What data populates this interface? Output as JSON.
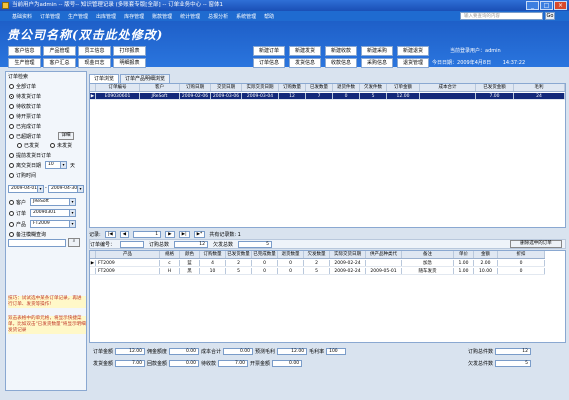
{
  "window": {
    "title": "当前用户为admin -- 版号-- 知识管理记录 (多账套专版[全部] -- 订单业务中心 -- 窗体1",
    "buttons": [
      "_",
      "□",
      "×"
    ]
  },
  "menu": [
    "基础资料",
    "订单管理",
    "生产管理",
    "出库管理",
    "库存管理",
    "账款管理",
    "统计管理",
    "总报分析",
    "系统管理",
    "帮助"
  ],
  "search": {
    "placeholder": "输入要查询的内容",
    "go": "Go"
  },
  "header": {
    "brand": "贵公司名称(双击此处修改)",
    "left_buttons": [
      "客户信息",
      "产品管理",
      "员工信息",
      "打印报表",
      "生产管理",
      "客户汇总",
      "现金日志",
      "明细报表"
    ],
    "mid_buttons": [
      "新建订单",
      "新建发货",
      "新建收款",
      "新建采购",
      "新建退货",
      "订单信息",
      "发货信息",
      "收款信息",
      "采购信息",
      "退货管理"
    ],
    "current_user_label": "当前登录用户：",
    "current_user": "admin",
    "today_label": "今日日期：",
    "today": "2009年4月8日",
    "time": "14:37:22"
  },
  "left": {
    "section_title": "订单检索",
    "radios": [
      {
        "label": "全部订单",
        "on": false
      },
      {
        "label": "待发货订单",
        "on": true
      },
      {
        "label": "待收款订单",
        "on": false
      },
      {
        "label": "待开票订单",
        "on": false
      },
      {
        "label": "已完成订单",
        "on": false
      },
      {
        "label": "已超期订单",
        "on": false
      }
    ],
    "detail_button": "详细",
    "sub_radios": [
      "已发货",
      "未发货"
    ],
    "upcoming_label": "提前发货日订单",
    "days_label": "离交货日期",
    "days_value": "10",
    "days_unit": "天",
    "order_date_label": "订购时间",
    "date_from": "2009-04-01",
    "date_to": "2009-04-30",
    "customer_label": "客户",
    "customer_value": "JReSoft",
    "order_label": "订单",
    "order_value": "20090301",
    "product_label": "产品",
    "product_value": "FT2009",
    "remark_label": "备注模糊查询",
    "tip1": "技巧：试试选中某条订单记录，再进行订单、发货等操作!",
    "tip2": "双击表格中的单元格，将显示快捷菜单，比如双击\"已发货数量\"将显示明细发货记录"
  },
  "tabs": [
    "订单浏览",
    "订单产品明细浏览"
  ],
  "orders": {
    "columns": [
      "订单编号",
      "客户",
      "订购日期",
      "交货日期",
      "实际交货日期",
      "订购数量",
      "已发数量",
      "退货件数",
      "欠发件数",
      "订单金额",
      "成本合计",
      "已发货金额",
      "毛利"
    ],
    "rows": [
      [
        "E09030601",
        "JReSoft",
        "2009-02-06",
        "2009-03-06",
        "2009-03-04",
        "12",
        "7",
        "0",
        "5",
        "12.00",
        "",
        "7.00",
        "24"
      ]
    ]
  },
  "nav": {
    "label": "记录:",
    "current": "1",
    "total_label": "共有记录数: 1"
  },
  "detail_info": {
    "order_label": "订单编号：",
    "order_value": "",
    "qty_label": "订购总数",
    "qty_value": "12",
    "short_label": "欠发总数",
    "short_value": "5",
    "delete_button": "删除选中的订单"
  },
  "details": {
    "columns": [
      "产品",
      "规格",
      "颜色",
      "订购数量",
      "已发货数量",
      "已完成数量",
      "退货数量",
      "欠发数量",
      "实际交货日期",
      "供产品种类代",
      "备注",
      "单价",
      "金额",
      "折扣"
    ],
    "rows": [
      [
        "FT2009",
        "c",
        "蓝",
        "4",
        "2",
        "0",
        "0",
        "2",
        "2009-02-24",
        "",
        "加急",
        "1.00",
        "2.00",
        "0"
      ],
      [
        "FT2009",
        "H",
        "黑",
        "10",
        "5",
        "0",
        "0",
        "5",
        "2009-02-24",
        "2009-05-01",
        "随车发货",
        "1.00",
        "10.00",
        "0"
      ]
    ]
  },
  "summary": {
    "row1": [
      {
        "label": "订单金额",
        "value": "12.00"
      },
      {
        "label": "佣金额度",
        "value": "0.00"
      },
      {
        "label": "成本合计",
        "value": "0.00"
      },
      {
        "label": "预测毛利",
        "value": "12.00"
      },
      {
        "label": "毛利率",
        "value": "100"
      }
    ],
    "row2": [
      {
        "label": "发货金额",
        "value": "7.00"
      },
      {
        "label": "回款金额",
        "value": "0.00"
      },
      {
        "label": "待收款",
        "value": "7.00"
      },
      {
        "label": "开票金额",
        "value": "0.00"
      }
    ],
    "total_qty_label": "订购总件数",
    "total_qty": "12",
    "short_total_label": "欠发总件数",
    "short_total": "5"
  }
}
